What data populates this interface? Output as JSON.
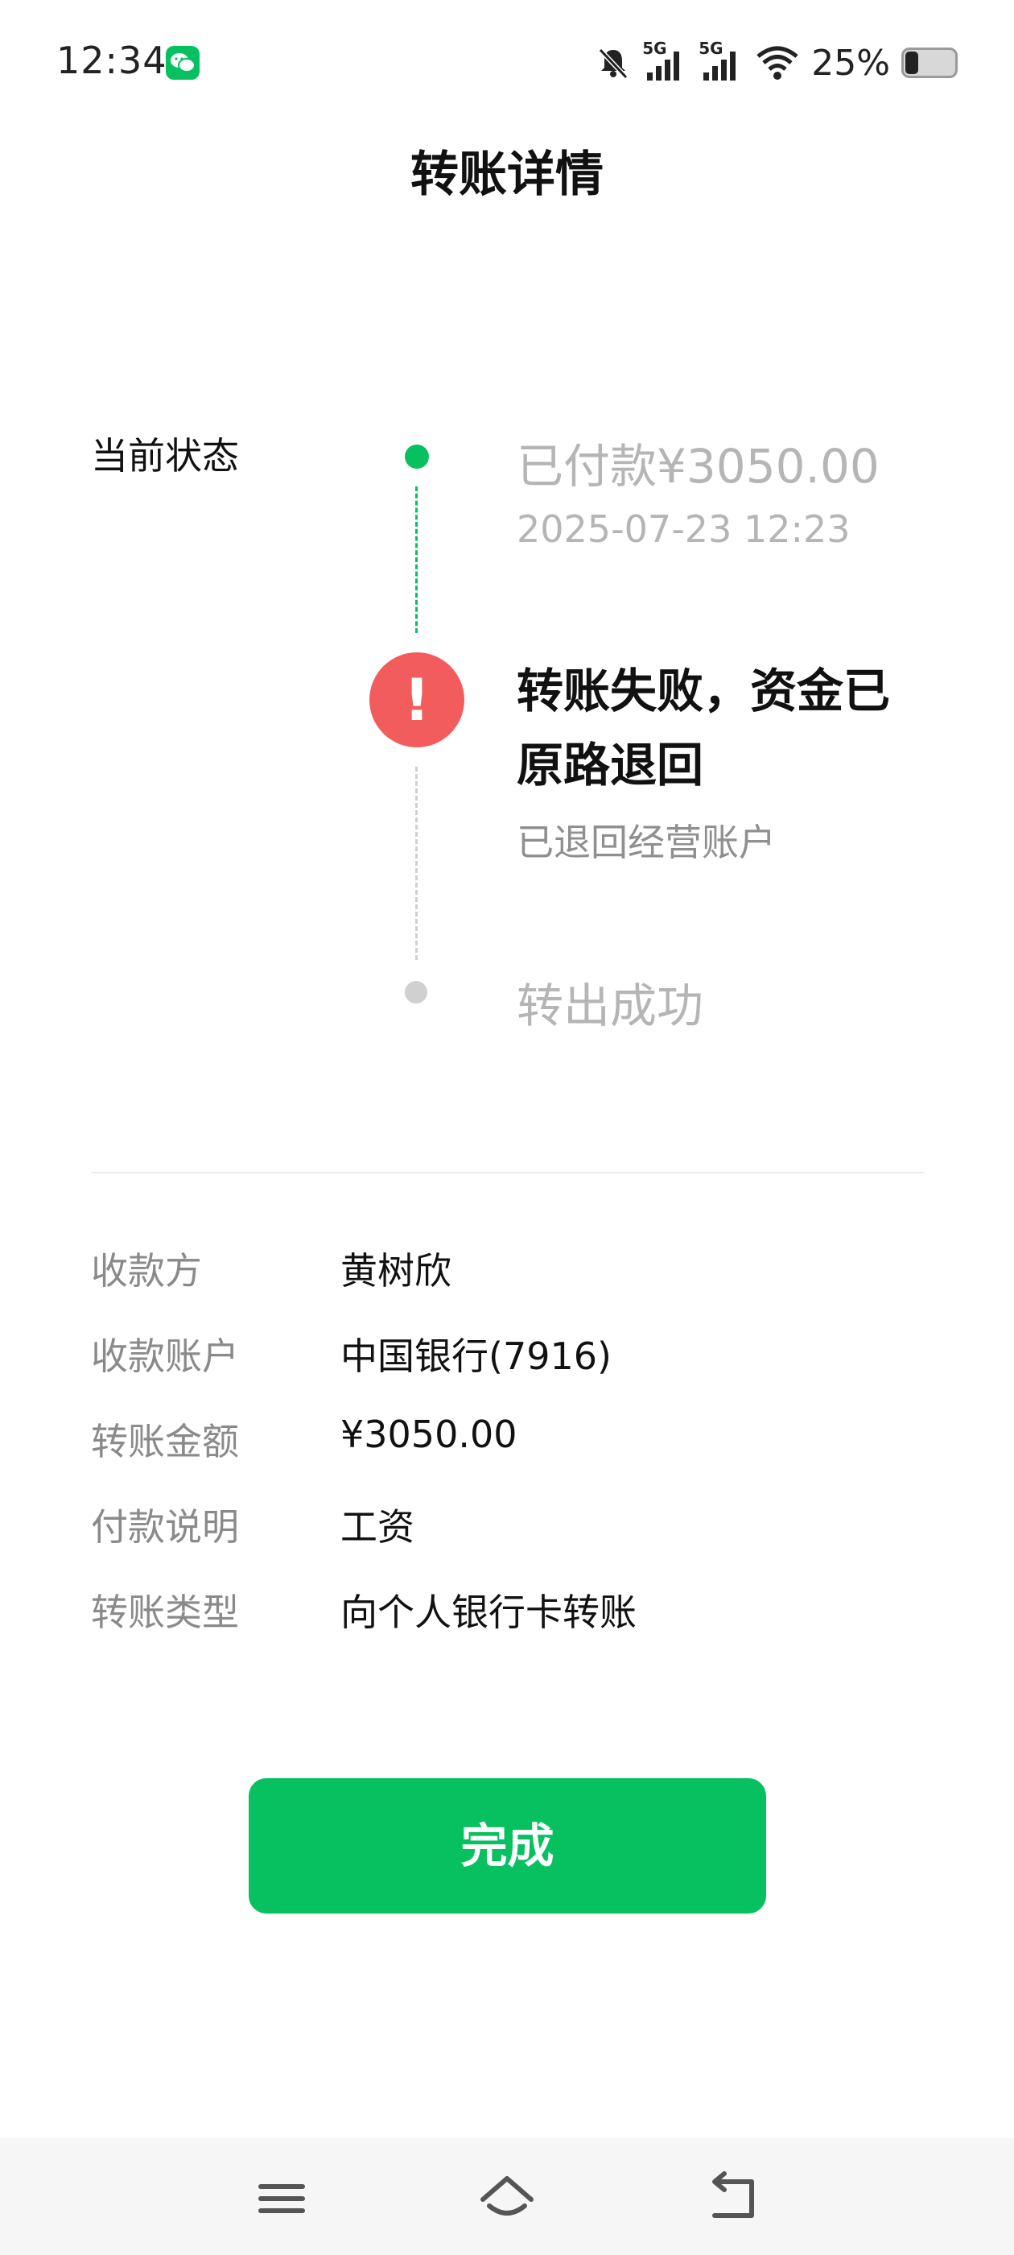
{
  "status_bar": {
    "time": "12:34",
    "network_1": "5G",
    "network_2": "5G",
    "battery": "25%"
  },
  "header": {
    "title": "转账详情"
  },
  "timeline": {
    "label": "当前状态",
    "steps": [
      {
        "title": "已付款¥3050.00",
        "subtitle": "2025-07-23 12:23",
        "state": "done",
        "color": "#07c160"
      },
      {
        "title": "转账失败，资金已原路退回",
        "subtitle": "已退回经营账户",
        "state": "error",
        "color": "#f25c5c"
      },
      {
        "title": "转出成功",
        "state": "pending",
        "color": "#d0d0d0"
      }
    ]
  },
  "details": [
    {
      "label": "收款方",
      "value": "黄树欣"
    },
    {
      "label": "收款账户",
      "value": "中国银行(7916)"
    },
    {
      "label": "转账金额",
      "value": "¥3050.00"
    },
    {
      "label": "付款说明",
      "value": "工资"
    },
    {
      "label": "转账类型",
      "value": "向个人银行卡转账"
    }
  ],
  "done_button": {
    "label": "完成",
    "color": "#07c160"
  },
  "nav": {
    "icons": [
      "menu-icon",
      "home-icon",
      "back-icon"
    ]
  }
}
